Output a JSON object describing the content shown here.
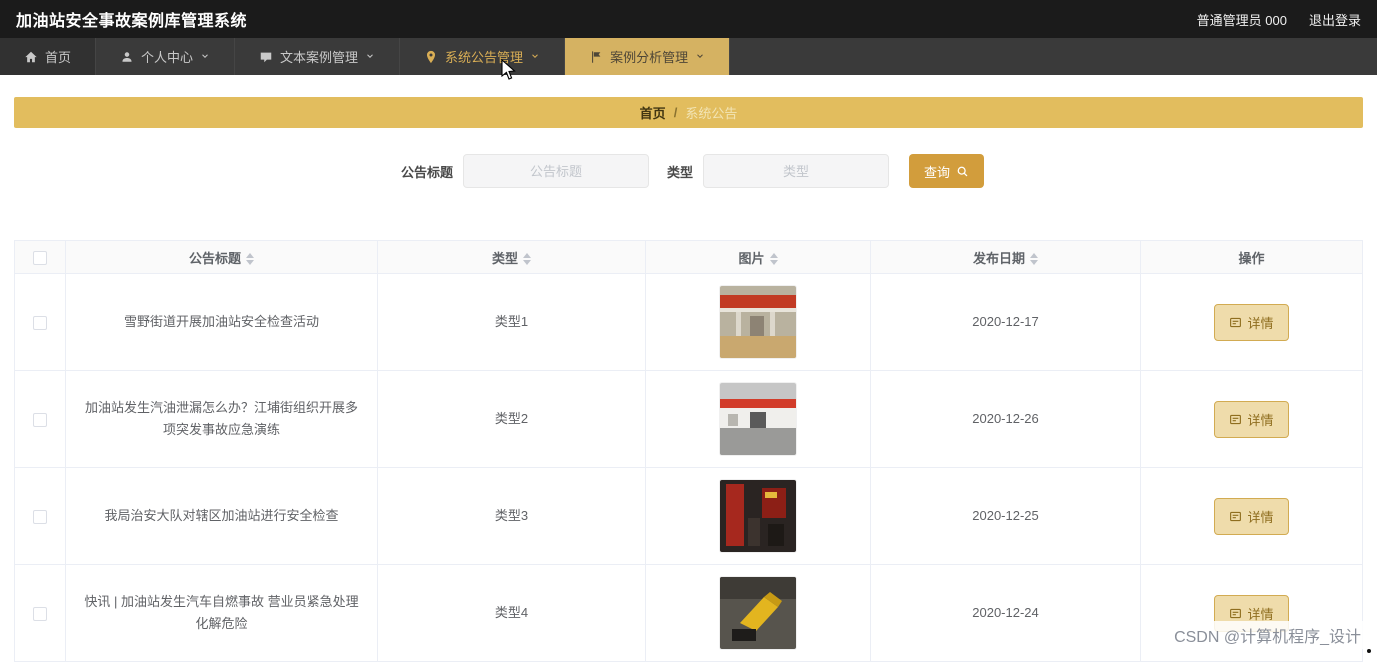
{
  "header": {
    "title": "加油站安全事故案例库管理系统",
    "user": "普通管理员 000",
    "logout": "退出登录"
  },
  "nav": {
    "items": [
      {
        "label": "首页",
        "icon": "home-icon"
      },
      {
        "label": "个人中心",
        "icon": "user-icon"
      },
      {
        "label": "文本案例管理",
        "icon": "chat-icon"
      },
      {
        "label": "系统公告管理",
        "icon": "pin-icon",
        "state": "active"
      },
      {
        "label": "案例分析管理",
        "icon": "flag-icon",
        "state": "hovered"
      }
    ]
  },
  "breadcrumb": {
    "root": "首页",
    "separator": "/",
    "current": "系统公告"
  },
  "search": {
    "title_label": "公告标题",
    "title_placeholder": "公告标题",
    "type_label": "类型",
    "type_placeholder": "类型",
    "submit_label": "查询"
  },
  "table": {
    "columns": [
      {
        "label": "公告标题",
        "sortable": true
      },
      {
        "label": "类型",
        "sortable": true
      },
      {
        "label": "图片",
        "sortable": true
      },
      {
        "label": "发布日期",
        "sortable": true
      },
      {
        "label": "操作",
        "sortable": false
      }
    ],
    "rows": [
      {
        "title": "雪野街道开展加油站安全检查活动",
        "type": "类型1",
        "image": "gas-station-photo-red-canopy",
        "date": "2020-12-17",
        "action": "详情"
      },
      {
        "title": "加油站发生汽油泄漏怎么办？江埔街组织开展多项突发事故应急演练",
        "type": "类型2",
        "image": "gas-station-photo-building",
        "date": "2020-12-26",
        "action": "详情"
      },
      {
        "title": "我局治安大队对辖区加油站进行安全检查",
        "type": "类型3",
        "image": "gas-station-photo-night",
        "date": "2020-12-25",
        "action": "详情"
      },
      {
        "title": "快讯 | 加油站发生汽车自燃事故 营业员紧急处理化解危险",
        "type": "类型4",
        "image": "fuel-nozzle-photo",
        "date": "2020-12-24",
        "action": "详情"
      }
    ]
  },
  "watermark": "CSDN @计算机程序_设计",
  "colors": {
    "header_bg": "#1b1b1b",
    "nav_bg": "#3a3a3a",
    "accent_gold": "#d29d3c",
    "breadcrumb_bg": "#e2bd5e",
    "nav_active_text": "#d9ae55",
    "nav_hover_bg": "#d5b262",
    "detail_btn_bg": "#efdcab",
    "detail_btn_border": "#d2ab52"
  }
}
